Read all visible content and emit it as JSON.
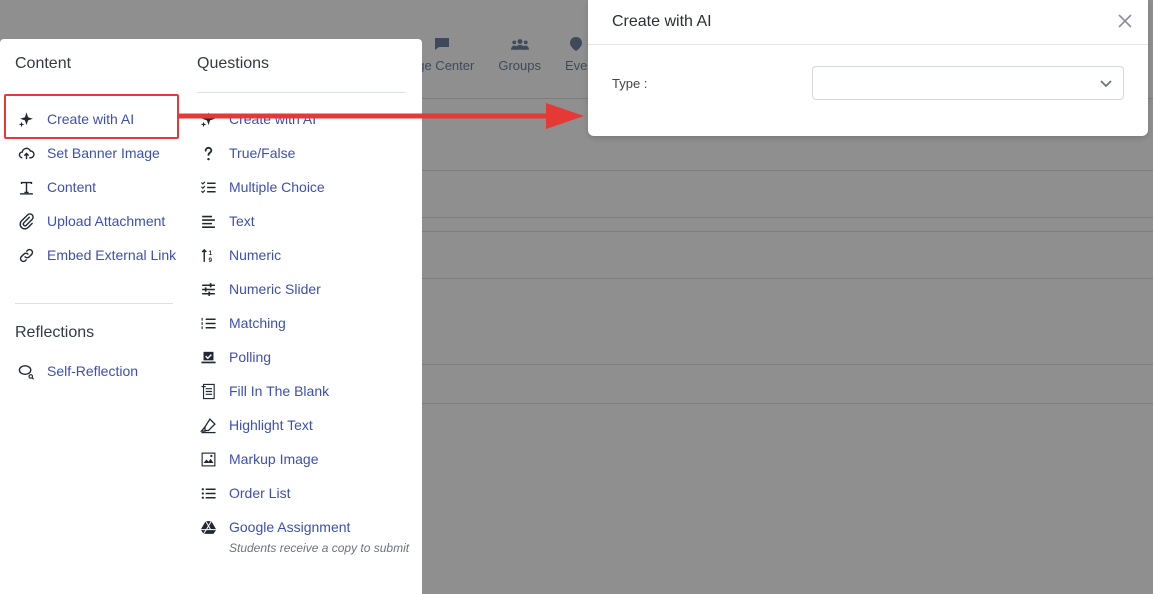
{
  "background": {
    "nav": [
      {
        "label": "age Center",
        "icon": "message-icon"
      },
      {
        "label": "Groups",
        "icon": "groups-icon"
      },
      {
        "label": "Eve",
        "icon": "event-icon"
      }
    ]
  },
  "menu": {
    "content_heading": "Content",
    "content_items": [
      {
        "label": "Create with AI",
        "icon": "sparkle-icon"
      },
      {
        "label": "Set Banner Image",
        "icon": "cloud-upload-icon"
      },
      {
        "label": "Content",
        "icon": "text-format-icon"
      },
      {
        "label": "Upload Attachment",
        "icon": "paperclip-icon"
      },
      {
        "label": "Embed External Link",
        "icon": "link-icon"
      }
    ],
    "reflections_heading": "Reflections",
    "reflection_items": [
      {
        "label": "Self-Reflection",
        "icon": "reflection-icon"
      }
    ],
    "questions_heading": "Questions",
    "question_items": [
      {
        "label": "Create with AI",
        "icon": "sparkle-icon"
      },
      {
        "label": "True/False",
        "icon": "question-mark-icon"
      },
      {
        "label": "Multiple Choice",
        "icon": "checklist-icon"
      },
      {
        "label": "Text",
        "icon": "text-lines-icon"
      },
      {
        "label": "Numeric",
        "icon": "numeric-sort-icon"
      },
      {
        "label": "Numeric Slider",
        "icon": "sliders-icon"
      },
      {
        "label": "Matching",
        "icon": "numbered-list-icon"
      },
      {
        "label": "Polling",
        "icon": "ballot-icon"
      },
      {
        "label": "Fill In The Blank",
        "icon": "form-doc-icon"
      },
      {
        "label": "Highlight Text",
        "icon": "highlighter-icon"
      },
      {
        "label": "Markup Image",
        "icon": "image-edit-icon"
      },
      {
        "label": "Order List",
        "icon": "bulleted-list-icon"
      },
      {
        "label": "Google Assignment",
        "icon": "google-drive-icon"
      }
    ],
    "google_assignment_subtext": "Students receive a copy to submit"
  },
  "dialog": {
    "title": "Create with AI",
    "type_label": "Type :",
    "type_value": ""
  },
  "colors": {
    "accent": "#3c4fb5",
    "highlight": "#e53935",
    "overlay": "#8f8f8f"
  }
}
